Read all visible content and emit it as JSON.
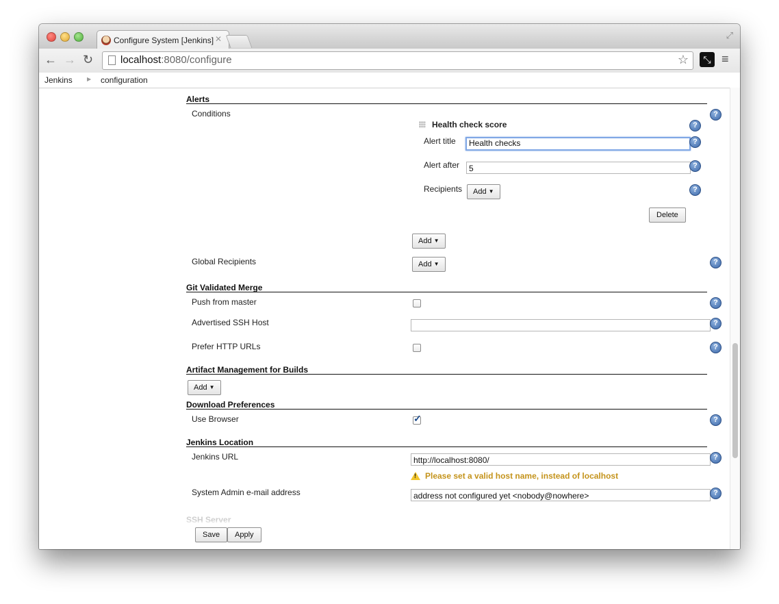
{
  "browser": {
    "tab_title": "Configure System [Jenkins]",
    "url_host": "localhost",
    "url_rest": ":8080/configure"
  },
  "breadcrumb": [
    "Jenkins",
    "configuration"
  ],
  "alerts": {
    "section_title": "Alerts",
    "conditions_label": "Conditions",
    "condition_title": "Health check score",
    "alert_title_label": "Alert title",
    "alert_title_value": "Health checks",
    "alert_after_label": "Alert after",
    "alert_after_value": "5",
    "recipients_label": "Recipients",
    "recipients_add": "Add",
    "delete_button": "Delete",
    "conditions_add": "Add",
    "global_recipients_label": "Global Recipients",
    "global_recipients_add": "Add"
  },
  "git_merge": {
    "section_title": "Git Validated Merge",
    "push_from_master_label": "Push from master",
    "push_from_master_checked": false,
    "ssh_host_label": "Advertised SSH Host",
    "ssh_host_value": "",
    "prefer_http_label": "Prefer HTTP URLs",
    "prefer_http_checked": false
  },
  "artifact": {
    "section_title": "Artifact Management for Builds",
    "add_button": "Add"
  },
  "download": {
    "section_title": "Download Preferences",
    "use_browser_label": "Use Browser",
    "use_browser_checked": true
  },
  "location": {
    "section_title": "Jenkins Location",
    "url_label": "Jenkins URL",
    "url_value": "http://localhost:8080/",
    "warning": "Please set a valid host name, instead of localhost",
    "admin_email_label": "System Admin e-mail address",
    "admin_email_value": "address not configured yet <nobody@nowhere>"
  },
  "faded_section": "SSH Server",
  "footer": {
    "save": "Save",
    "apply": "Apply"
  },
  "help_glyph": "?",
  "colors": {
    "help_blue": "#3b67a8",
    "warning_text": "#c4931b",
    "focus_ring": "#7fa7e5"
  }
}
